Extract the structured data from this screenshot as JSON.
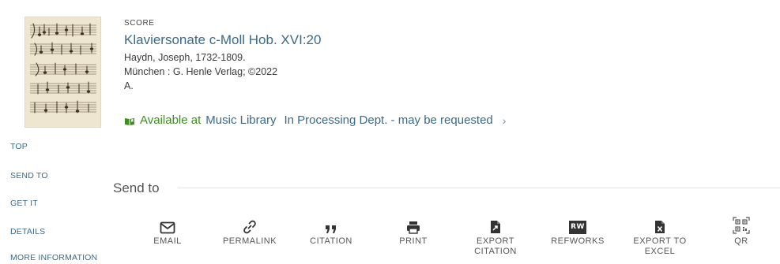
{
  "record": {
    "type": "SCORE",
    "title": "Klaviersonate c-Moll Hob. XVI:20",
    "author": "Haydn, Joseph, 1732-1809.",
    "publisher": "München : G. Henle Verlag; ©2022",
    "edition": "A.",
    "thumbnail_icon": "sheet-music-thumbnail",
    "availability": {
      "status": "Available at",
      "library": "Music Library",
      "location": "In Processing Dept. - may be requested",
      "chevron": "›"
    }
  },
  "leftnav": {
    "items": [
      "TOP",
      "SEND TO",
      "GET IT",
      "DETAILS",
      "MORE INFORMATION"
    ]
  },
  "sendto": {
    "heading": "Send to",
    "actions": [
      {
        "label": "EMAIL",
        "icon": "envelope-icon"
      },
      {
        "label": "PERMALINK",
        "icon": "link-icon"
      },
      {
        "label": "CITATION",
        "icon": "quote-icon"
      },
      {
        "label": "PRINT",
        "icon": "printer-icon"
      },
      {
        "label": "EXPORT CITATION",
        "icon": "export-file-icon"
      },
      {
        "label": "REFWORKS",
        "icon": "refworks-icon",
        "badge": "RW"
      },
      {
        "label": "EXPORT TO EXCEL",
        "icon": "excel-icon"
      },
      {
        "label": "QR",
        "icon": "qr-code-icon"
      }
    ]
  },
  "colors": {
    "link": "#3d6987",
    "available": "#3a8f1d"
  }
}
